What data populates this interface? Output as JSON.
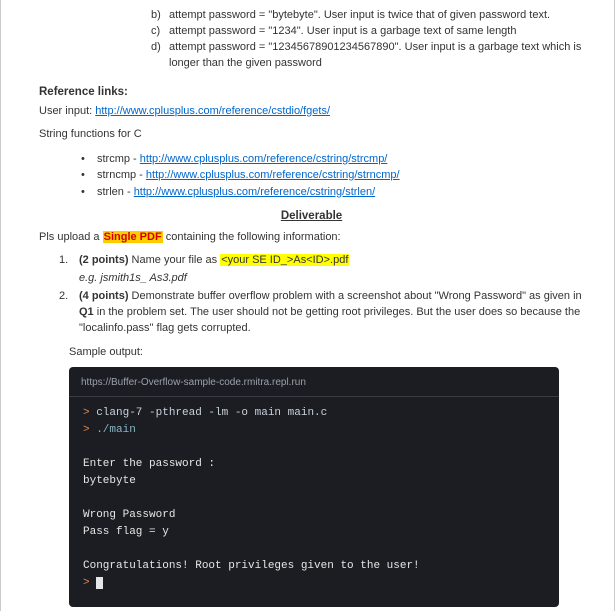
{
  "sublist": {
    "b": {
      "marker": "b)",
      "text": "attempt password = \"bytebyte\". User input is twice that of given password text."
    },
    "c": {
      "marker": "c)",
      "text": "attempt password = \"1234\". User input is a garbage text of same length"
    },
    "d": {
      "marker": "d)",
      "text": "attempt password = \"12345678901234567890\". User input is a garbage text which is longer than the given password"
    }
  },
  "refs": {
    "heading": "Reference links:",
    "user_input_label": "User input: ",
    "user_input_link": "http://www.cplusplus.com/reference/cstdio/fgets/",
    "string_fn_label": "String functions for C",
    "items": {
      "strcmp": {
        "name": "strcmp - ",
        "url": "http://www.cplusplus.com/reference/cstring/strcmp/"
      },
      "strncmp": {
        "name": "strncmp - ",
        "url": "http://www.cplusplus.com/reference/cstring/strncmp/"
      },
      "strlen": {
        "name": "strlen - ",
        "url": "http://www.cplusplus.com/reference/cstring/strlen/"
      }
    }
  },
  "deliverable": {
    "title": "Deliverable",
    "pls_prefix": "Pls upload a ",
    "single_pdf": "Single PDF",
    "pls_suffix": " containing the following information:",
    "item1": {
      "marker": "1.",
      "points": "(2 points)",
      "prefix": " Name your file as ",
      "hl": "<your SE ID_>As<ID>.pdf",
      "eg": "e.g. jsmith1s_ As3.pdf"
    },
    "item2": {
      "marker": "2.",
      "points": "(4 points)",
      "text_a": " Demonstrate buffer overflow problem with a screenshot about \"Wrong Password\" as given in ",
      "q1": "Q1",
      "text_b": " in the problem set. The user should not be getting root privileges. But the user does so because the \"localinfo.pass\" flag gets corrupted."
    },
    "sample_label": "Sample output:"
  },
  "terminal": {
    "url": "https://Buffer-Overflow-sample-code.rmitra.repl.run",
    "lines": {
      "l1a": "> ",
      "l1b": "clang-7 -pthread -lm -o main main.c",
      "l2a": "> ",
      "l2b": "./main",
      "l3": "    Enter the   password    :",
      "l4": "bytebyte",
      "l5": "    Wrong Password",
      "l6": "Pass flag = y",
      "l7": "   Congratulations! Root privileges given to   the user!",
      "l8": "> "
    }
  }
}
